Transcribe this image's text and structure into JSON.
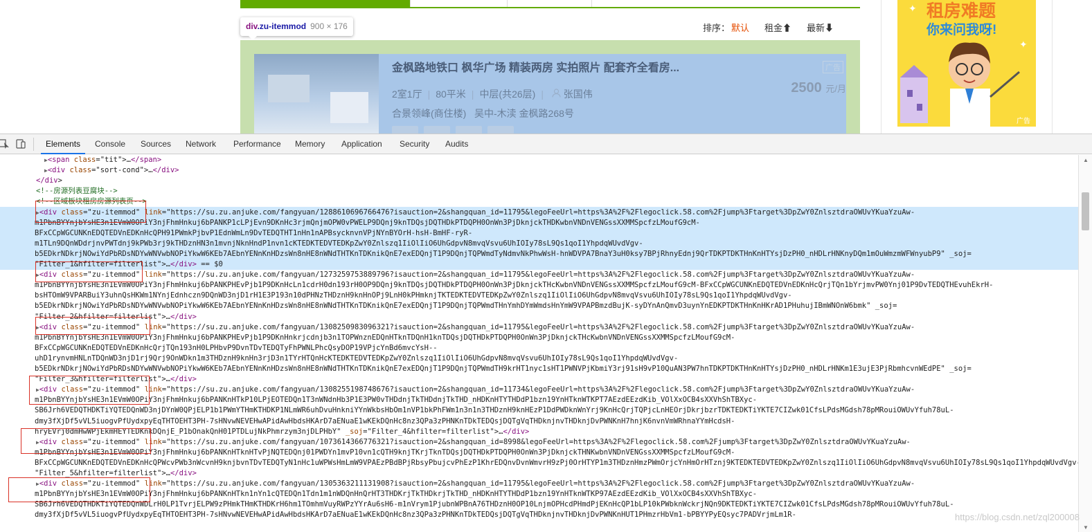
{
  "site": {
    "tooltip": {
      "tag": "div",
      "cls": ".zu-itemmod",
      "size": "900 × 176"
    },
    "sort": {
      "label": "排序：",
      "default": "默认",
      "rent": "租金⬆",
      "newest": "最新⬇"
    },
    "listing": {
      "title": "金枫路地铁口 枫华广场 精装两房 实拍照片 配套齐全看房...",
      "layout": "2室1厅",
      "area": "80平米",
      "floor": "中层(共26层)",
      "agent": "张国伟",
      "community": "合景领峰(商住楼)",
      "location": "吴中-木渎 金枫路268号",
      "price": "2500",
      "price_unit": "元/月",
      "ad_tag": "广告"
    },
    "ad_banner": {
      "line1": "租房难题",
      "line2": "你来问我呀!",
      "tag": "广告"
    }
  },
  "devtools": {
    "tabs": [
      "Elements",
      "Console",
      "Sources",
      "Network",
      "Performance",
      "Memory",
      "Application",
      "Security",
      "Audits"
    ],
    "active_tab": "Elements",
    "lines": [
      {
        "indent": 3,
        "tri": true,
        "text": "<span class=\"tit\">…</span>"
      },
      {
        "indent": 3,
        "tri": true,
        "text": "<div class=\"sort-cond\">…</div>"
      },
      {
        "indent": 2,
        "tri": false,
        "text": "</div>"
      },
      {
        "indent": 2,
        "tri": false,
        "text": "<!--房源列表豆腐块-->"
      },
      {
        "indent": 2,
        "tri": false,
        "text": "<!--区域板块租房房源列表页-->"
      },
      {
        "indent": 2,
        "tri": true,
        "text": "<div class=\"zu-itemmod\" link=\"https://su.zu.anjuke.com/fangyuan/1288610696766476?isauction=2&shangquan_id=11795&legoFeeUrl=https%3A%2F%2Flegoclick.58.com%2Fjump%3Ftarget%3DpZwY0ZnlsztdraOWUvYKuaYzuAw-"
      },
      {
        "indent": 0,
        "tri": false,
        "text": "m1PbnBYYnjbYsHE3n1EVmW0OPiY3njFhmHnkuj6bPANKP1cLPjEvn9DKnHc3rjmQnjmOPW0vPWELP9DQnj9knTDQsjDQTHDkPTDQPH0OnWn3PjDknjckTHDKwbnVNDnVENGssXXMMSpcfzLMoufG9cM-"
      },
      {
        "indent": 0,
        "tri": false,
        "text": "BFxCCpWGCUNKnEDQTEDVnEDKnHcQPH91PWmkPjbvP1EdnWmLn9DvTEDQTHT1nHn1nAPBsycknvnVPjNYnBYOrH-hsH-BmHF-ryR-"
      },
      {
        "indent": 0,
        "tri": false,
        "text": "m1TLn9DQnWDdrjnvPWTdnj9kPWb3rj9kTHDznHN3n1mvnjNknHndP1nvn1cKTEDKTEDVTEDKpZwY0Znlszq1IiOlIiO6UhGdpvN8mvqVsvu6UhIOIy78sL9Qs1qoI1YhpdqWUvdVgv-"
      },
      {
        "indent": 0,
        "tri": false,
        "text": "b5EDkrNDkrjNOwiYdPbRDsNDYwWNVwbNOPiYkwW6KEb7AEbnYENnKnHDzsWn8nHE8nWNdTHTKnTDKnikQnE7exEDQnjT1P9DQnjTQPWmdTyNdmvNkPhwWsH-hnWDVPA7BnaY3uH0ksy7BPjRhnyEdnj9QrTDKPTDKTHnKnHTYsjDzPH0_nHDLrHNKnyDQm1mOuWmzmWFWnyubP9\" _soj="
      },
      {
        "indent": 0,
        "tri": false,
        "text": "\"Filter_1&hfilter=filterlist\">…</div> == $0"
      },
      {
        "indent": 2,
        "tri": true,
        "text": "<div class=\"zu-itemmod\" link=\"https://su.zu.anjuke.com/fangyuan/1273259753889796?isauction=2&shangquan_id=11795&legoFeeUrl=https%3A%2F%2Flegoclick.58.com%2Fjump%3Ftarget%3DpZwY0ZnlsztdraOWUvYKuaYzuAw-"
      },
      {
        "indent": 0,
        "tri": false,
        "text": "m1PbnBYYnjbYsHE3n1EVmW0OPiY3njFhmHnkuj6bPANKPHEvPjb1P9DKnHcLn1cdrH0dn193rH0OP9DQnj9knTDQsjDQTHDkPTDQPH0OnWn3PjDknjckTHcKwbnVNDnVENGssXXMMSpcfzLMoufG9cM-BFxCCpWGCUNKnEDQTEDVnEDKnHcQrjTQn1bYrjmvPW0Ynj01P9DvTEDQTHEvuhEkrH-"
      },
      {
        "indent": 0,
        "tri": false,
        "text": "bsHTOmW9VPARBuiY3uhnQsHKWm1NYnjEdnhczn9DQnWD3njD1rH1E3P193n10dPHNzTHDznH9knHnOPj9LnH0kPHmknjTKTEDKTEDVTEDKpZwY0Znlszq1IiOlIiO6UhGdpvN8mvqVsvu6UhIOIy78sL9Qs1qoI1YhpdqWUvdVgv-"
      },
      {
        "indent": 0,
        "tri": false,
        "text": "b5EDkrNDkrjNOwiYdPbRDsNDYwWNVwbNOPiYkwW6KEb7AEbnYENnKnHDzsWn8nHE8nWNdTHTKnTDKnikQnE7exEDQnjT1P9DQnjTQPWmdTHnYmhDYmWmdsHnYmW9VPAPBmzdBujK-syDYnAnQmvD3uynYnEDKPTDKTHnKnHKrAD1PHuhujIBmWNOnW6bmk\" _soj="
      },
      {
        "indent": 0,
        "tri": false,
        "text": "\"Filter_2&hfilter=filterlist\">…</div>"
      },
      {
        "indent": 2,
        "tri": true,
        "text": "<div class=\"zu-itemmod\" link=\"https://su.zu.anjuke.com/fangyuan/1308250983096321?isauction=2&shangquan_id=11795&legoFeeUrl=https%3A%2F%2Flegoclick.58.com%2Fjump%3Ftarget%3DpZwY0ZnlsztdraOWUvYKuaYzuAw-"
      },
      {
        "indent": 0,
        "tri": false,
        "text": "m1PbnBYYnjbYsHE3n1EVmW0OPiY3njFhmHnkuj6bPANKPHEvPjb1P9DKnHnkrjcdnjb3n1TOPWnznEDQnHTknTDQnH1knTDQsjDQTHDkPTDQPH0OnWn3PjDknjckTHcKwbnVNDnVENGssXXMMSpcfzLMoufG9cM-"
      },
      {
        "indent": 0,
        "tri": false,
        "text": "BFxCCpWGCUNKnEDQTEDVnEDKnHcQrjTQn193nH0LPHbvP9DvnTDvTEDQTyFhPWNLPhcQsyDOP19VPjcYnBd6mvcYsH--"
      },
      {
        "indent": 0,
        "tri": false,
        "text": "uhD1rynvmHNLnTDQnWD3njD1rj9Qrj9OnWDkn1m3THDznH9knHn3rjD3n1TYrHTQnHcKTEDKTEDVTEDKpZwY0Znlszq1IiOlIiO6UhGdpvN8mvqVsvu6UhIOIy78sL9Qs1qoI1YhpdqWUvdVgv-"
      },
      {
        "indent": 0,
        "tri": false,
        "text": "b5EDkrNDkrjNOwiYdPbRDsNDYwWNVwbNOPiYkwW6KEb7AEbnYENnKnHDzsWn8nHE8nWNdTHTKnTDKnikQnE7exEDQnjT1P9DQnjTQPWmdTH9krHT1nyc1sHT1PWNVPjKbmiY3rj91sH9vP10QuAN3PW7hnTDKPTDKTHnKnHTYsjDzPH0_nHDLrHNKm1E3ujE3PjRbmhcvnWEdPE\" _soj="
      },
      {
        "indent": 0,
        "tri": false,
        "text": "\"Filter_3&hfilter=filterlist\">…</div>"
      },
      {
        "indent": 2,
        "tri": true,
        "text": "<div class=\"zu-itemmod\" link=\"https://su.zu.anjuke.com/fangyuan/1308255198748676?isauction=2&shangquan_id=11734&legoFeeUrl=https%3A%2F%2Flegoclick.58.com%2Fjump%3Ftarget%3DpZwY0ZnlsztdraOWUvYKuaYzuAw-"
      },
      {
        "indent": 0,
        "tri": false,
        "text": "m1PbnBYYnjbYsHE3n1EVmW0OPiY3njFhmHnkuj6bPANKnHTkP10LPjEOTEDQn1T3nWNdnHb3P1E3PW0vTHDdnjTkTHDdnjTkTHD_nHDKnHTYTHDdP1bzn19YnHTknWTKPT7AEzdEEzdKib_VOlXxOCB4sXXVhShTBXyc-"
      },
      {
        "indent": 0,
        "tri": false,
        "text": "SB6Jrh6VEDQTHDKTiYQTEDQnWD3njDYnW0QPjELP1b1PWmYTHmKTHDKP1NLmWR6uhDvuHnkniYYnWkbsHbOm1nVP1bkPhFWm1n3n1n3THDznH9knHEzP1DdPWDknWnYrj9KnHcQrjTQPjcLnHEOrjDkrjbzrTDKTEDKTiYKTE7CIZwk01CfsLPdsMGdsh78pMRouiOWUvYfuh78uL-"
      },
      {
        "indent": 0,
        "tri": false,
        "text": "dmy3fXjDf5vVL5iuogvPfUydxpyEqTHTOEHT3PH-7sHNvwNEVEHwAPidAwHbdsHKArD7aENuaE1wKEkDQnHc8nz3QPa3zPHNKnTDkTEDQsjDQTgVqTHDknjnvTHDknjDvPWNKnH7hnjK6nvnVmWRhnaYYmHcdsH-"
      },
      {
        "indent": 0,
        "tri": false,
        "text": "hryEVrj0dmHwWPjEkmHEYTEDKnkDQnjE_P1bOnakQnH01PTDLujNkPhmrzym3njDLPHbY\" _soj=\"Filter_4&hfilter=filterlist\">…</div>"
      },
      {
        "indent": 2,
        "tri": true,
        "text": "<div class=\"zu-itemmod\" link=\"https://su.zu.anjuke.com/fangyuan/1073614366776321?isauction=2&shangquan_id=8998&legoFeeUrl=https%3A%2F%2Flegoclick.58.com%2Fjump%3Ftarget%3DpZwY0ZnlsztdraOWUvYKuaYzuAw-"
      },
      {
        "indent": 0,
        "tri": false,
        "text": "m1PbnBYYnjbYsHE3n1EVmW0OPiY3njFhmHnkuj6bPANKnHTknHTvPjNQTEDQnj01PWDYn1mvP10vn1cQTH9knjTKrjTknTDQsjDQTHDkPTDQPH0OnWn3PjDknjckTHNKwbnVNDnVENGssXXMMSpcfzLMoufG9cM-"
      },
      {
        "indent": 0,
        "tri": false,
        "text": "BFxCCpWGCUNKnEDQTEDVnEDKnHcQPWcvPWb3nWcvnH9knjbvnTDvTEDQTyN1nHc1uWPWsHmLmW9VPAEzPBdBPjRbsyPbujcvPhEzP1KhrEDQnvDvnWmvrH9zPj0OrHTYP1m3THDznHmzPWmOrjcYnHmOrHTznj9KTEDKTEDVTEDKpZwY0Znlszq1IiOlIiO6UhGdpvN8mvqVsvu6UhIOIy78sL9Qs1qoI1YhpdqWUvdVgv-b5EDkrNDkrjNOwiYdPbRDsNDYwWNVwbNOPiYkwW6KEb7AEbnYENnKnHDzsWn8nHE8nWNdTHTKnTDKnikQnE7exEDQnjT1P9DQnjTQPWmdTyn1nvPbuWIbsyRbPHTVPj03nBdBPyDdsH7hPHwWuHubrAwhrTDKPTDKTHnKnHTYsjDzPH0_rjbOrTD3mhPBuAw6nj-buWmdPW-B\" _soj="
      },
      {
        "indent": 0,
        "tri": false,
        "text": "\"Filter_5&hfilter=filterlist\">…</div>"
      },
      {
        "indent": 2,
        "tri": true,
        "text": "<div class=\"zu-itemmod\" link=\"https://su.zu.anjuke.com/fangyuan/1305363211131908?isauction=2&shangquan_id=11795&legoFeeUrl=https%3A%2F%2Flegoclick.58.com%2Fjump%3Ftarget%3DpZwY0ZnlsztdraOWUvYKuaYzuAw-"
      },
      {
        "indent": 0,
        "tri": false,
        "text": "m1PbnBYYnjbYsHE3n1EVmW0OPiY3njFhmHnkuj6bPANKnHTkn1nYn1cQTEDQn1Tdn1m1nWDQnHnQrHT3THDKrjTkTHDkrjTkTHD_nHDKnHTYTHDdP1bzn19YnHTknWTKP97AEzdEEzdKib_VOlXxOCB4sXXVhShTBXyc-"
      },
      {
        "indent": 0,
        "tri": false,
        "text": "SB6Jrh6VEDQTHDKTiYQTEDQnWDLrH0LP1TvrjELPW9zPHmkTHmKTHDKrH6hm1TOmhmVuyRWPzYYrAu6sH6-m1nVrym1PjubnWPBnA76THDznH0OP10LnjmOPHcdPHmdPjEKnHcQP1bLP10kPWbknWckrjNQn9DKTEDKTiYKTE7CIZwk01CfsLPdsMGdsh78pMRouiOWUvYfuh78uL-"
      },
      {
        "indent": 0,
        "tri": false,
        "text": "dmy3fXjDf5vVL5iuogvPfUydxpyEqTHTOEHT3PH-7sHNvwNEVEHwAPidAwHbdsHKArD7aENuaE1wKEkDQnHc8nz3QPa3zPHNKnTDkTEDQsjDQTgVqTHDknjnvTHDknjDvPWNKnHUT1PHmzrHbVm1-bPBYYPyEQsyc7PADVrjmLm1R-"
      }
    ],
    "watermark": "https://blog.csdn.net/zql200008"
  }
}
